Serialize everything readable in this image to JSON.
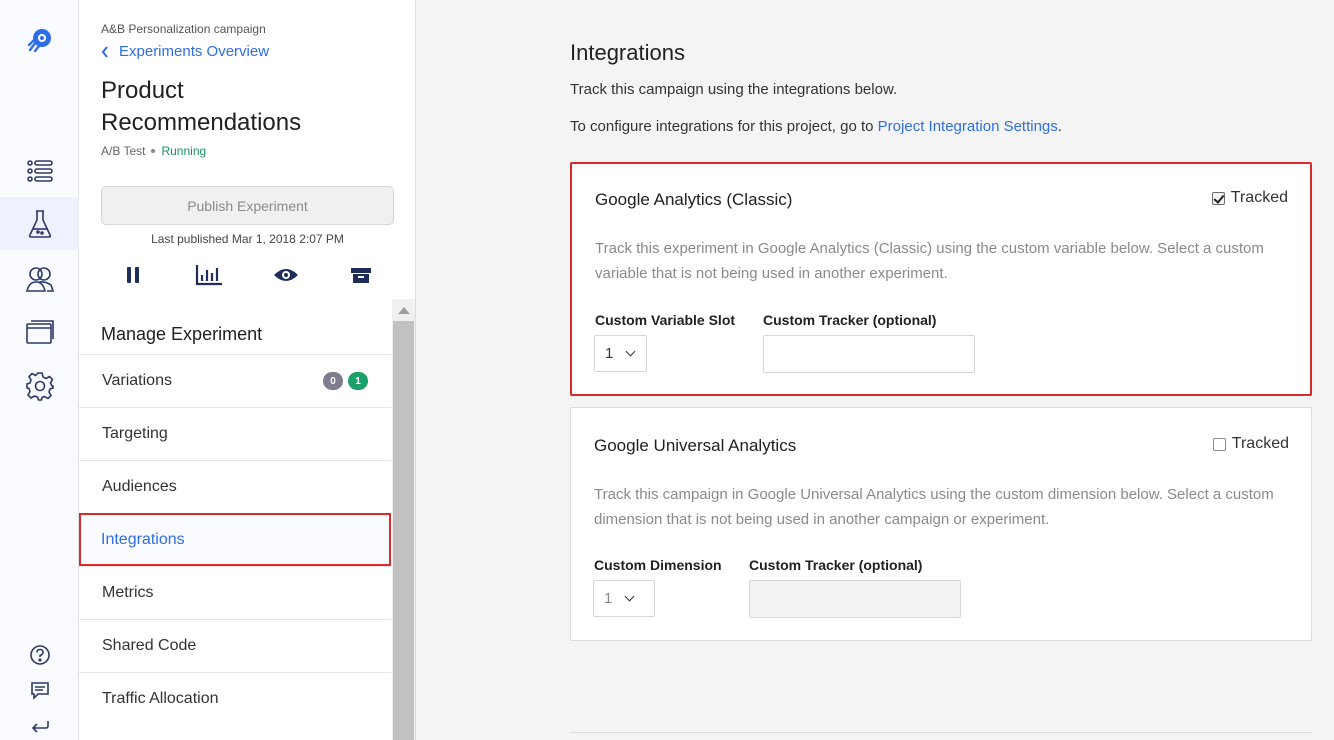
{
  "rail": {
    "icons": [
      "logo-icon",
      "list-icon",
      "flask-icon",
      "audiences-icon",
      "windows-icon",
      "settings-icon",
      "help-icon",
      "feedback-icon",
      "exit-icon"
    ]
  },
  "sidebar": {
    "campaign": "A&B Personalization campaign",
    "back_link": "Experiments Overview",
    "title": "Product Recommendations",
    "type": "A/B Test",
    "status": "Running",
    "publish_label": "Publish Experiment",
    "last_published": "Last published Mar 1, 2018 2:07 PM",
    "section_title": "Manage Experiment",
    "items": [
      {
        "label": "Variations",
        "badges": [
          "0",
          "1"
        ]
      },
      {
        "label": "Targeting"
      },
      {
        "label": "Audiences"
      },
      {
        "label": "Integrations"
      },
      {
        "label": "Metrics"
      },
      {
        "label": "Shared Code"
      },
      {
        "label": "Traffic Allocation"
      }
    ]
  },
  "main": {
    "heading": "Integrations",
    "subtitle": "Track this campaign using the integrations below.",
    "configure_text": "To configure integrations for this project, go to ",
    "configure_link": "Project Integration Settings",
    "configure_end": ".",
    "cards": [
      {
        "title": "Google Analytics (Classic)",
        "tracked_label": "Tracked",
        "tracked": true,
        "description": "Track this experiment in Google Analytics (Classic) using the custom variable below. Select a custom variable that is not being used in another experiment.",
        "field1_label": "Custom Variable Slot",
        "field1_value": "1",
        "field2_label": "Custom Tracker (optional)",
        "field2_value": ""
      },
      {
        "title": "Google Universal Analytics",
        "tracked_label": "Tracked",
        "tracked": false,
        "description": "Track this campaign in Google Universal Analytics using the custom dimension below. Select a custom dimension that is not being used in another campaign or experiment.",
        "field1_label": "Custom Dimension",
        "field1_value": "1",
        "field2_label": "Custom Tracker (optional)",
        "field2_value": ""
      }
    ]
  },
  "colors": {
    "accent": "#2e6ee8",
    "highlight": "#d92b2b",
    "running": "#19935b",
    "badge_gray": "#7d7d8f",
    "badge_green": "#1c9f68"
  }
}
